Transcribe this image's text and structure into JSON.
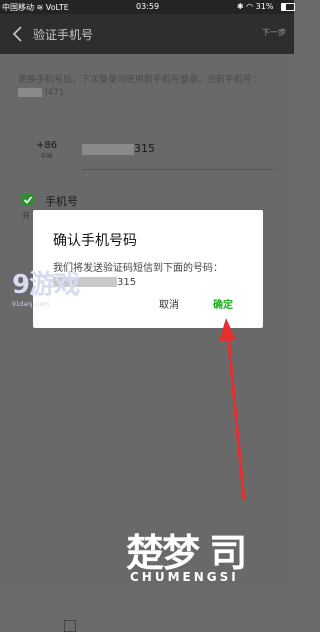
{
  "status_bar": {
    "carrier": "中国移动",
    "network": "VoLTE",
    "time": "03:59",
    "battery": "31%",
    "battery_level": 0.31
  },
  "header": {
    "title": "验证手机号",
    "next_label": "下一步"
  },
  "main": {
    "description": "更换手机号后，下次登录可使用新手机号登录。当前手机号：",
    "current_phone_tail": "l471",
    "country_code": "+86",
    "region": "中国",
    "phone_tail": "315",
    "checkbox_label": "手机号",
    "checkbox_sub": "开"
  },
  "dialog": {
    "title": "确认手机号码",
    "body": "我们将发送验证码短信到下面的号码：",
    "number_tail": "315",
    "cancel_label": "取消",
    "confirm_label": "确定"
  },
  "watermark": {
    "logo": "9游戏",
    "site": "91danji.com"
  },
  "brand": {
    "glyphs": "楚梦 司",
    "name": "CHUMENGSI"
  },
  "colors": {
    "accent": "#1aad19",
    "arrow": "#e53030"
  }
}
